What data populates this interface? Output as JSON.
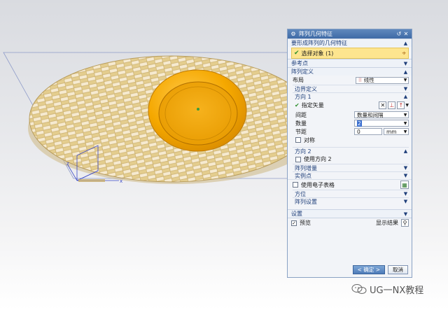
{
  "dialog": {
    "title": "阵列几何特征",
    "sections": {
      "geometry": "要形成阵列的几何特征",
      "select_object": "选择对象 (1)",
      "reference_point": "参考点",
      "array_definition": "阵列定义",
      "layout_label": "布局",
      "layout_value": "线性",
      "boundary": "边界定义",
      "direction1": "方向 1",
      "specify_vector": "指定矢量",
      "spacing_label": "间距",
      "spacing_value": "数量和间隔",
      "count_label": "数量",
      "count_value": "2",
      "pitch_label": "节距",
      "pitch_value": "0",
      "pitch_unit": "mm",
      "symmetric": "对称",
      "direction2": "方向 2",
      "use_direction2": "使用方向 2",
      "array_increment": "阵列增量",
      "instance_point": "实例点",
      "use_spreadsheet": "使用电子表格",
      "orientation": "方位",
      "array_settings": "阵列设置",
      "settings": "设置",
      "preview": "预览",
      "show_result": "显示结果",
      "ok": "< 确定 >",
      "cancel": "取消"
    }
  },
  "watermark": "UG一NX教程",
  "colors": {
    "accent": "#4d7bb8",
    "highlight": "#fde58f",
    "orange": "#f2a400",
    "mesh": "#e8d49b"
  }
}
